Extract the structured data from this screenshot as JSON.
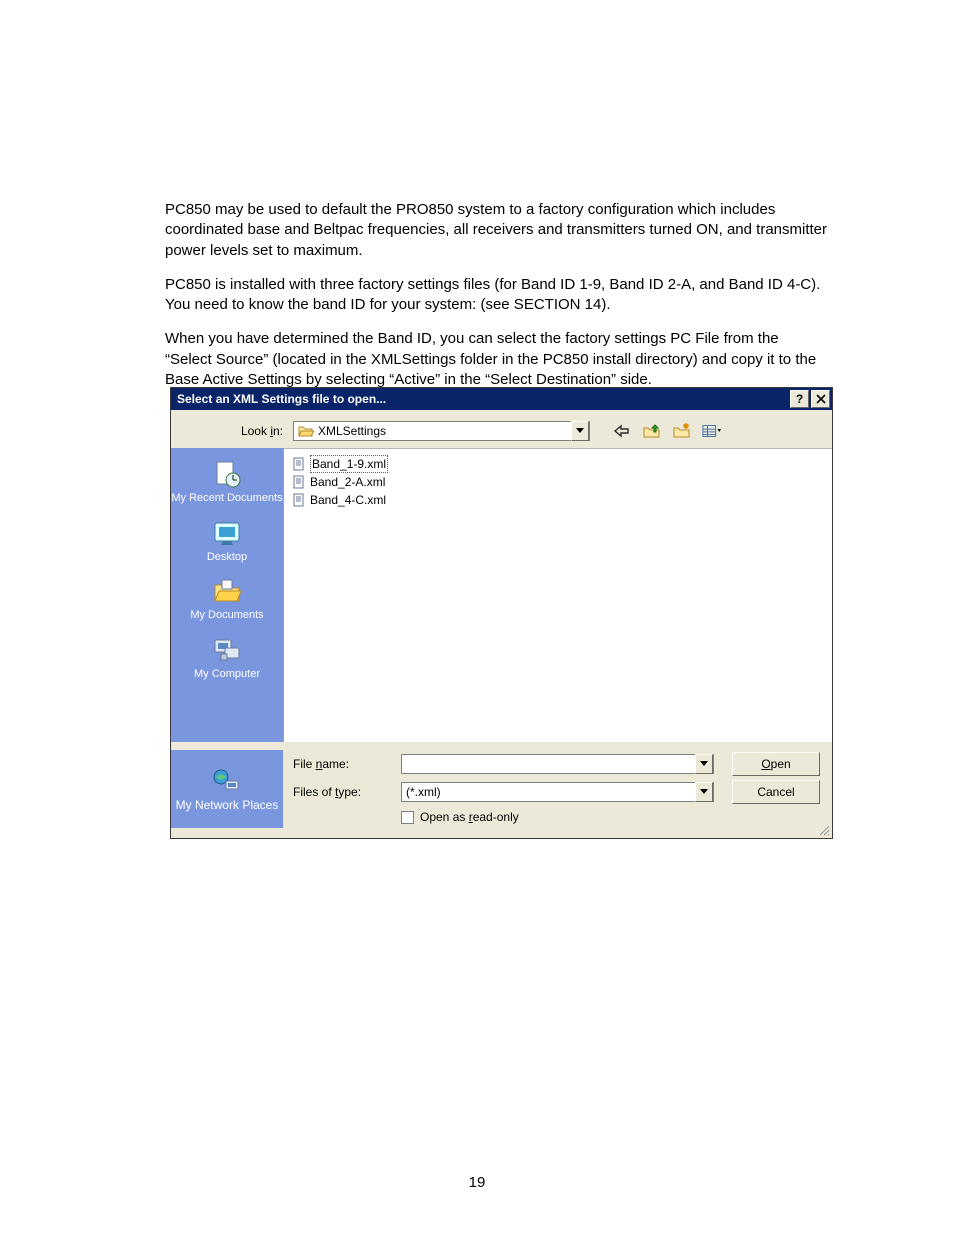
{
  "paragraphs": [
    "PC850 may be used to default the PRO850 system to a factory configuration which includes coordinated base and Beltpac frequencies, all receivers and transmitters turned ON, and transmitter power levels set to maximum.",
    "PC850 is installed with three factory settings files (for Band ID 1-9, Band ID 2-A, and Band ID 4-C). You need to know the band ID for your system: (see SECTION 14).",
    "When you have determined the Band ID, you can select the factory settings PC File from the “Select Source” (located in the XMLSettings folder in the PC850 install directory) and copy it to the Base Active Settings by selecting “Active” in the “Select Destination” side."
  ],
  "page_number": "19",
  "dialog": {
    "title": "Select an XML Settings file to open...",
    "lookin_label_pre": "Look ",
    "lookin_label_u": "i",
    "lookin_label_post": "n:",
    "lookin_value": "XMLSettings",
    "places": [
      "My Recent Documents",
      "Desktop",
      "My Documents",
      "My Computer"
    ],
    "bottom_place": "My Network Places",
    "files": [
      "Band_1-9.xml",
      "Band_2-A.xml",
      "Band_4-C.xml"
    ],
    "filename_label_pre": "File ",
    "filename_label_u": "n",
    "filename_label_post": "ame:",
    "filename_value": "",
    "filetype_label_pre": "Files of ",
    "filetype_label_u": "t",
    "filetype_label_post": "ype:",
    "filetype_value": "(*.xml)",
    "readonly_pre": "Open as ",
    "readonly_u": "r",
    "readonly_post": "ead-only",
    "open_u": "O",
    "open_post": "pen",
    "cancel": "Cancel"
  }
}
